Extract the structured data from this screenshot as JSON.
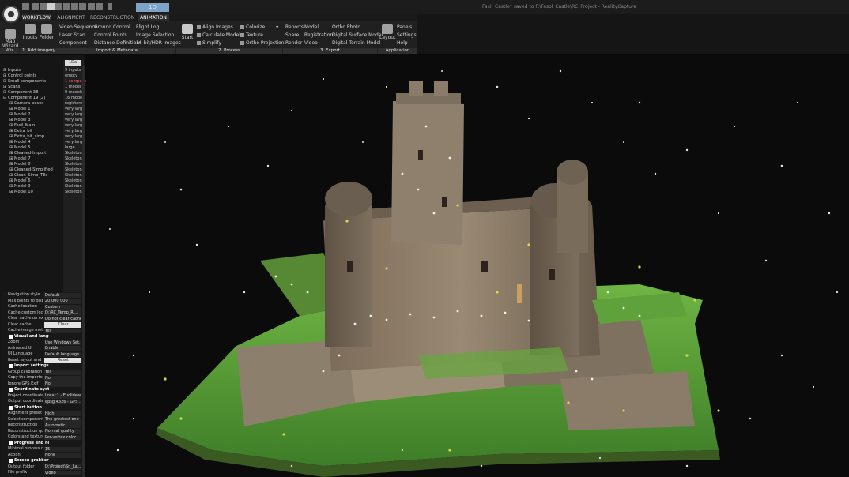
{
  "window": {
    "title": "Fasil_Castle* saved to F:\\Fasol_Castle\\RC_Project - RealityCapture",
    "view_mode": "1D"
  },
  "tabs": [
    {
      "label": "WORKFLOW",
      "active": true
    },
    {
      "label": "ALIGNMENT",
      "active": false
    },
    {
      "label": "RECONSTRUCTION",
      "active": false
    },
    {
      "label": "ANIMATION",
      "active": true
    }
  ],
  "ribbon": {
    "wiz": {
      "map_wizard": "Map\nWizard"
    },
    "add_imagery": {
      "inputs": "Inputs",
      "folder": "Folder"
    },
    "import": {
      "col1": [
        "Video Sequence",
        "Laser Scan",
        "Component"
      ],
      "col2": [
        "Ground Control",
        "Control Points",
        "Distance Definitions"
      ],
      "col3": [
        "Flight Log",
        "Image Selection",
        "16-bit/HDR Images"
      ]
    },
    "process": {
      "start": "Start",
      "col1": [
        "Align Images",
        "Calculate Model",
        "Simplify"
      ],
      "col2": [
        "Colorize",
        "Texture",
        "Ortho Projection"
      ]
    },
    "export": {
      "col1": [
        "Reports",
        "Share",
        "Render"
      ],
      "col2": [
        "Model",
        "Registration",
        "Video"
      ],
      "col3": [
        "Ortho Photo",
        "Digital Surface Model",
        "Digital Terrain Model"
      ]
    },
    "application": {
      "layout": "Layout",
      "col": [
        "Panels",
        "Settings",
        "Help"
      ]
    },
    "groups": [
      "Wiz",
      "1. Add imagery",
      "Import & Metadata",
      "2. Process",
      "3. Export",
      "Application"
    ]
  },
  "tree": {
    "dropdown": "1Da",
    "items": [
      "Inputs",
      "Control points",
      "Small components",
      "Scans",
      "Component 38",
      "Component 19 (2)",
      "Camera poses",
      "Model 1",
      "Model 2",
      "Model 3",
      "Fasil_Main",
      "Extra_bit",
      "Extra_bit_simp",
      "Model 4",
      "Model 5",
      "Cleaned-Import",
      "Model 7",
      "Model 8",
      "Cleaned-Simplified",
      "Clean_Simp_TEx",
      "Model 6",
      "Model 9",
      "Model 10"
    ],
    "values": [
      "9 inputs",
      "empty",
      "1 component",
      "1 model",
      "0 models",
      "16 models",
      "registered",
      "very large",
      "very large",
      "very large",
      "very large",
      "very large",
      "very large",
      "very large",
      "large",
      "Skeleton",
      "Skeleton",
      "Skeleton",
      "Skeleton",
      "Skeleton",
      "Skeleton",
      "Skeleton",
      "Skeleton"
    ]
  },
  "settings": [
    {
      "k": "Navigation style",
      "v": "Default"
    },
    {
      "k": "Max points to display",
      "v": "20 000 000"
    },
    {
      "k": "Cache location",
      "v": "Custom"
    },
    {
      "k": "Cache custom location",
      "v": "D:\\RC_Temp_Ri..."
    },
    {
      "k": "Clear cache on exit",
      "v": "Do not clear cache"
    },
    {
      "k": "Clear cache",
      "v": "Clear",
      "btn": true
    },
    {
      "k": "Cache image metadata",
      "v": "Yes"
    },
    {
      "head": "Visual and language settings"
    },
    {
      "k": "Zoom",
      "v": "Use Windows Set..."
    },
    {
      "k": "Animated UI",
      "v": "Enable"
    },
    {
      "k": "UI Language",
      "v": "Default language"
    },
    {
      "k": "Reset layout and settings",
      "v": "Reset",
      "btn": true
    },
    {
      "head": "Import settings"
    },
    {
      "k": "Group calibration",
      "v": "Yes"
    },
    {
      "k": "Copy the imported data",
      "v": "No"
    },
    {
      "k": "Ignore GPS Exif",
      "v": "No"
    },
    {
      "head": "Coordinate systems"
    },
    {
      "k": "Project coordinate system",
      "v": "Local:1 - Euclidean"
    },
    {
      "k": "Output coordinate system",
      "v": "epsg:4326 - GPS ..."
    },
    {
      "head": "Start button"
    },
    {
      "k": "Alignment preset",
      "v": "High"
    },
    {
      "k": "Select component",
      "v": "The greatest one"
    },
    {
      "k": "Reconstruction",
      "v": "Automatic"
    },
    {
      "k": "Reconstruction quality",
      "v": "Normal quality"
    },
    {
      "k": "Colors and textures",
      "v": "Per-vertex color"
    },
    {
      "head": "Progress end notification"
    },
    {
      "k": "Minimal process duration",
      "v": "15"
    },
    {
      "k": "Action",
      "v": "None"
    },
    {
      "head": "Screen grabber"
    },
    {
      "k": "Output folder",
      "v": "D:\\Project\\Sn_La..."
    },
    {
      "k": "File prefix",
      "v": "video"
    }
  ],
  "colors": {
    "accent": "#7da3c7",
    "alert": "#ff5a5a",
    "grass": "#5fae3a",
    "stone": "#8a7a66"
  }
}
